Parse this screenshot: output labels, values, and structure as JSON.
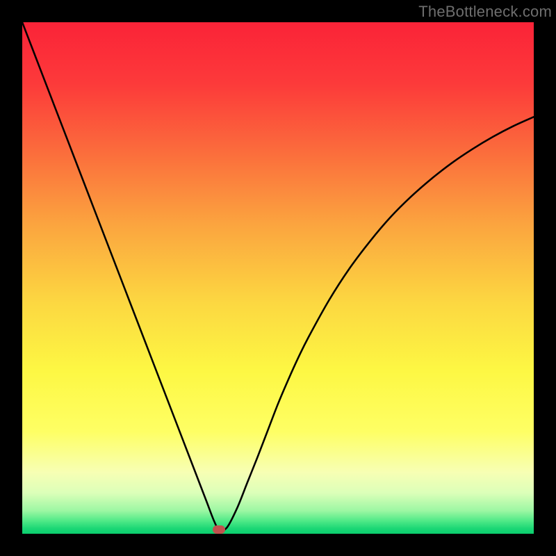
{
  "attribution": "TheBottleneck.com",
  "colors": {
    "background": "#000000",
    "gradient_stops": [
      {
        "pos": 0.0,
        "color": "#fb2338"
      },
      {
        "pos": 0.12,
        "color": "#fc3a3a"
      },
      {
        "pos": 0.25,
        "color": "#fb6b3c"
      },
      {
        "pos": 0.4,
        "color": "#fba63f"
      },
      {
        "pos": 0.55,
        "color": "#fcd841"
      },
      {
        "pos": 0.68,
        "color": "#fdf743"
      },
      {
        "pos": 0.8,
        "color": "#feff64"
      },
      {
        "pos": 0.88,
        "color": "#f7ffb4"
      },
      {
        "pos": 0.92,
        "color": "#dcffb9"
      },
      {
        "pos": 0.955,
        "color": "#9cf7a3"
      },
      {
        "pos": 0.975,
        "color": "#4fe987"
      },
      {
        "pos": 0.99,
        "color": "#1bd775"
      },
      {
        "pos": 1.0,
        "color": "#0bce6e"
      }
    ],
    "curve": "#000000",
    "marker": "#c1524e"
  },
  "chart_data": {
    "type": "line",
    "title": "",
    "xlabel": "",
    "ylabel": "",
    "x": [
      0,
      2,
      4,
      6,
      8,
      10,
      12,
      14,
      16,
      18,
      20,
      22,
      24,
      26,
      28,
      30,
      32,
      34,
      36,
      37.5,
      38.5,
      40,
      42,
      44,
      46,
      48,
      50,
      52,
      54,
      56,
      60,
      64,
      68,
      72,
      76,
      80,
      84,
      88,
      92,
      96,
      100
    ],
    "values": [
      100,
      94.8,
      89.6,
      84.4,
      79.2,
      74.0,
      68.8,
      63.6,
      58.4,
      53.2,
      48.0,
      42.8,
      37.6,
      32.4,
      27.2,
      22.0,
      16.8,
      11.6,
      6.4,
      2.5,
      0.8,
      1.2,
      5.0,
      10.0,
      15.0,
      20.2,
      25.4,
      30.1,
      34.5,
      38.5,
      45.7,
      51.9,
      57.2,
      61.9,
      65.9,
      69.4,
      72.5,
      75.2,
      77.6,
      79.7,
      81.5
    ],
    "xlim": [
      0,
      100
    ],
    "ylim": [
      0,
      100
    ],
    "marker": {
      "x": 38.5,
      "y": 0.8
    }
  }
}
